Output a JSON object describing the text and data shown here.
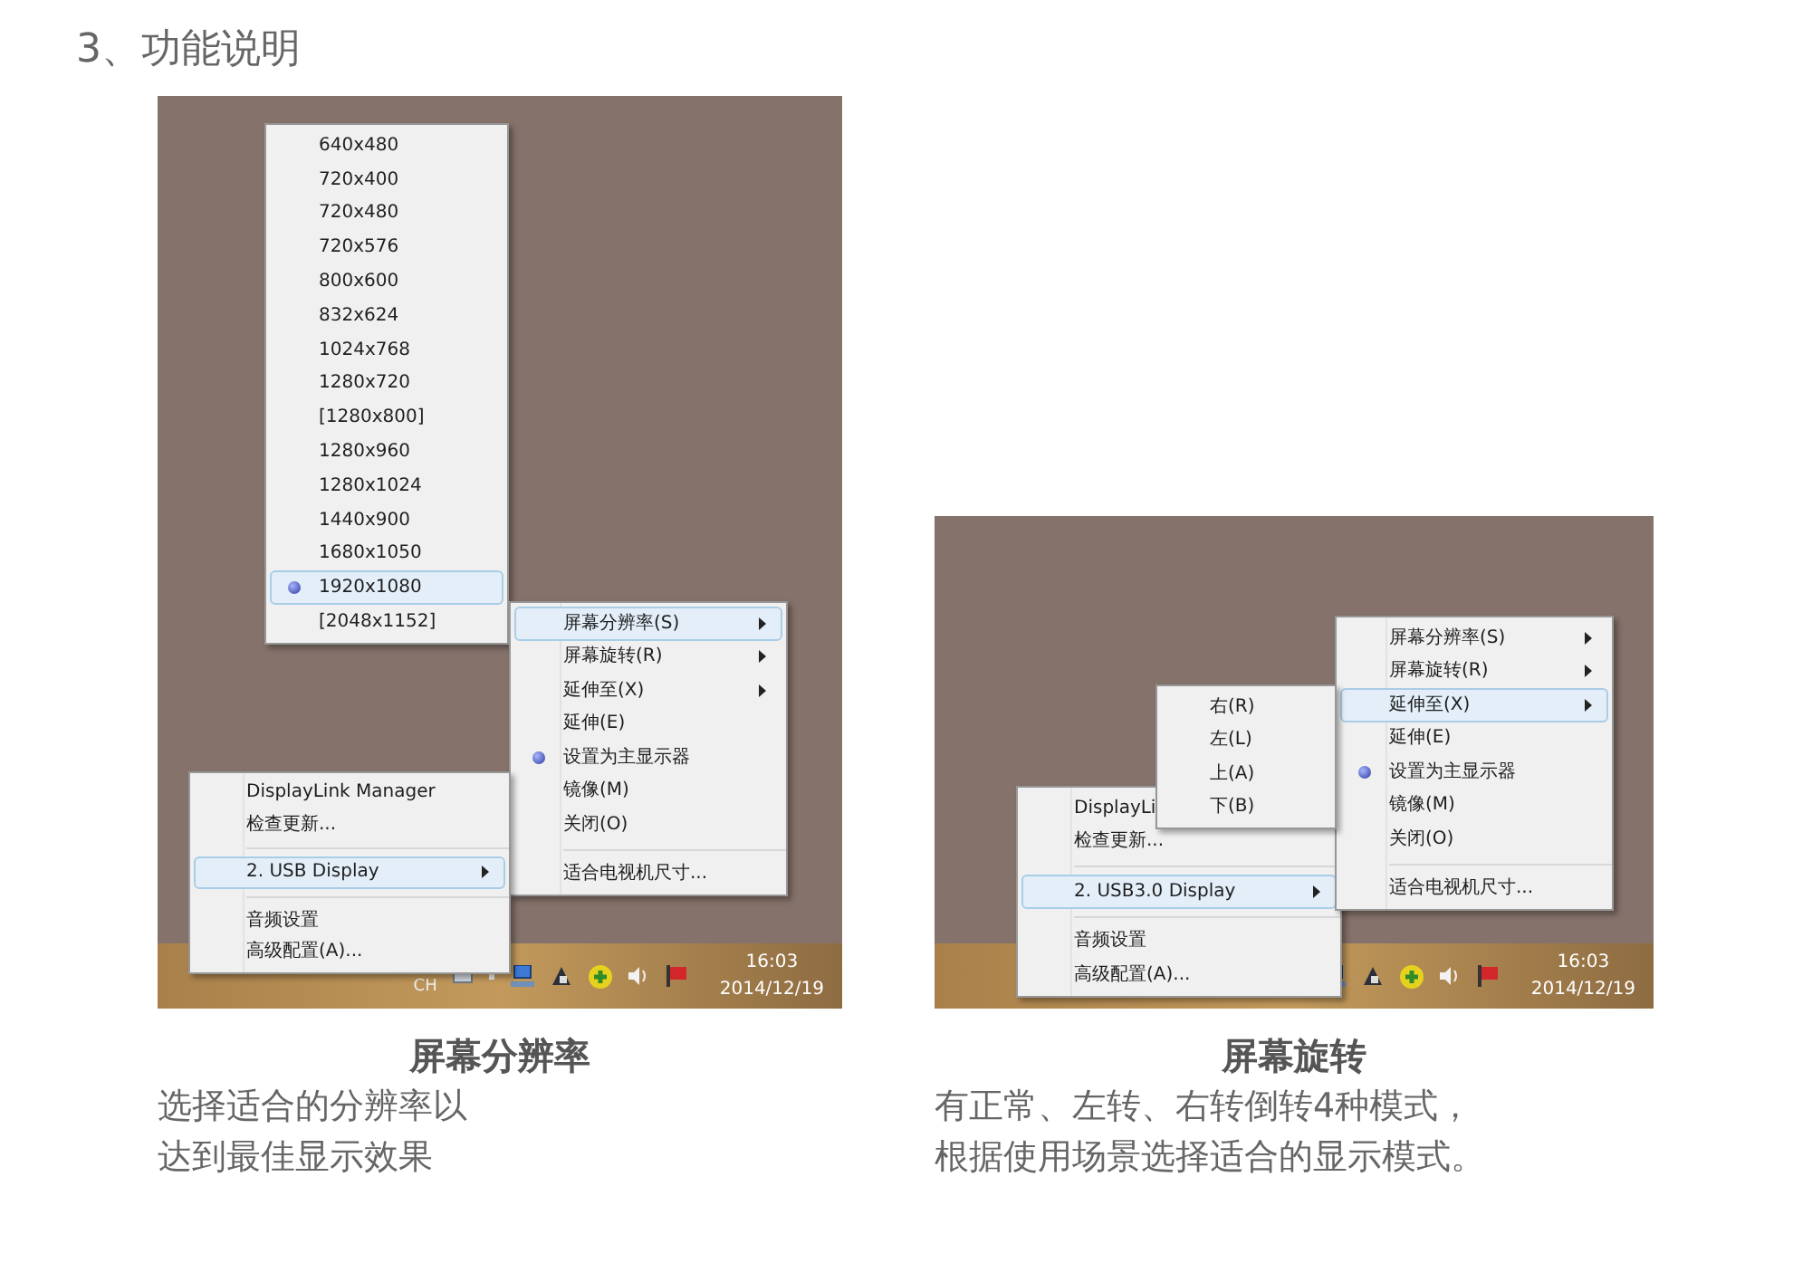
{
  "heading": "3、功能说明",
  "panels": [
    {
      "kind": "resolution",
      "resolution_menu": {
        "items": [
          {
            "label": "640x480",
            "selected": false
          },
          {
            "label": "720x400",
            "selected": false
          },
          {
            "label": "720x480",
            "selected": false
          },
          {
            "label": "720x576",
            "selected": false
          },
          {
            "label": "800x600",
            "selected": false
          },
          {
            "label": "832x624",
            "selected": false
          },
          {
            "label": "1024x768",
            "selected": false
          },
          {
            "label": "1280x720",
            "selected": false
          },
          {
            "label": "[1280x800]",
            "selected": false
          },
          {
            "label": "1280x960",
            "selected": false
          },
          {
            "label": "1280x1024",
            "selected": false
          },
          {
            "label": "1440x900",
            "selected": false
          },
          {
            "label": "1680x1050",
            "selected": false
          },
          {
            "label": "1920x1080",
            "selected": true
          },
          {
            "label": "[2048x1152]",
            "selected": false
          }
        ]
      },
      "display_menu": {
        "items": [
          {
            "kind": "item",
            "label": "屏幕分辨率(S)",
            "submenu": true,
            "selected": true,
            "checked": false
          },
          {
            "kind": "item",
            "label": "屏幕旋转(R)",
            "submenu": true,
            "selected": false,
            "checked": false
          },
          {
            "kind": "item",
            "label": "延伸至(X)",
            "submenu": true,
            "selected": false,
            "checked": false
          },
          {
            "kind": "item",
            "label": "延伸(E)",
            "submenu": false,
            "selected": false,
            "checked": false
          },
          {
            "kind": "item",
            "label": "设置为主显示器",
            "submenu": false,
            "selected": false,
            "checked": true
          },
          {
            "kind": "item",
            "label": "镜像(M)",
            "submenu": false,
            "selected": false,
            "checked": false
          },
          {
            "kind": "item",
            "label": "关闭(O)",
            "submenu": false,
            "selected": false,
            "checked": false
          },
          {
            "kind": "separator"
          },
          {
            "kind": "item",
            "label": "适合电视机尺寸...",
            "submenu": false,
            "selected": false,
            "checked": false
          }
        ]
      },
      "tray_menu": {
        "items": [
          {
            "kind": "item",
            "label": "DisplayLink Manager",
            "submenu": false,
            "selected": false
          },
          {
            "kind": "item",
            "label": "检查更新...",
            "submenu": false,
            "selected": false
          },
          {
            "kind": "separator"
          },
          {
            "kind": "item",
            "label": "2. USB  Display",
            "submenu": true,
            "selected": true
          },
          {
            "kind": "separator"
          },
          {
            "kind": "item",
            "label": "音频设置",
            "submenu": false,
            "selected": false
          },
          {
            "kind": "item",
            "label": "高级配置(A)...",
            "submenu": false,
            "selected": false
          }
        ]
      },
      "taskbar": {
        "language": "CH",
        "time": "16:03",
        "date": "2014/12/19"
      },
      "caption": {
        "title": "屏幕分辨率",
        "lines": [
          "选择适合的分辨率以",
          "达到最佳显示效果"
        ]
      }
    },
    {
      "kind": "rotation",
      "display_menu": {
        "items": [
          {
            "kind": "item",
            "label": "屏幕分辨率(S)",
            "submenu": true,
            "selected": false,
            "checked": false
          },
          {
            "kind": "item",
            "label": "屏幕旋转(R)",
            "submenu": true,
            "selected": false,
            "checked": false
          },
          {
            "kind": "item",
            "label": "延伸至(X)",
            "submenu": true,
            "selected": true,
            "checked": false
          },
          {
            "kind": "item",
            "label": "延伸(E)",
            "submenu": false,
            "selected": false,
            "checked": false
          },
          {
            "kind": "item",
            "label": "设置为主显示器",
            "submenu": false,
            "selected": false,
            "checked": true
          },
          {
            "kind": "item",
            "label": "镜像(M)",
            "submenu": false,
            "selected": false,
            "checked": false
          },
          {
            "kind": "item",
            "label": "关闭(O)",
            "submenu": false,
            "selected": false,
            "checked": false
          },
          {
            "kind": "separator"
          },
          {
            "kind": "item",
            "label": "适合电视机尺寸...",
            "submenu": false,
            "selected": false,
            "checked": false
          }
        ]
      },
      "direction_menu": {
        "items": [
          {
            "label": "右(R)",
            "selected": false
          },
          {
            "label": "左(L)",
            "selected": false
          },
          {
            "label": "上(A)",
            "selected": false
          },
          {
            "label": "下(B)",
            "selected": false
          }
        ]
      },
      "tray_menu": {
        "items": [
          {
            "kind": "item",
            "label": "DisplayLi",
            "selected": false
          },
          {
            "kind": "item",
            "label": "检查更新...",
            "submenu": false,
            "selected": false
          },
          {
            "kind": "separator"
          },
          {
            "kind": "item",
            "label": "2. USB3.0  Display",
            "submenu": true,
            "selected": true
          },
          {
            "kind": "separator"
          },
          {
            "kind": "item",
            "label": "音频设置",
            "submenu": false,
            "selected": false
          },
          {
            "kind": "item",
            "label": "高级配置(A)...",
            "submenu": false,
            "selected": false
          }
        ]
      },
      "taskbar": {
        "time": "16:03",
        "date": "2014/12/19"
      },
      "caption": {
        "title": "屏幕旋转",
        "lines": [
          "有正常、左转、右转倒转4种模式，",
          "根据使用场景选择适合的显示模式。"
        ]
      }
    }
  ]
}
